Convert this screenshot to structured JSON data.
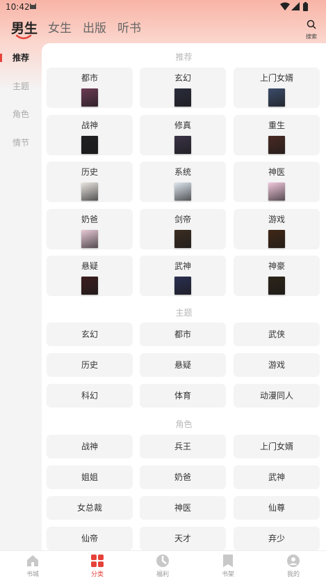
{
  "status": {
    "time": "10:42"
  },
  "top_tabs": [
    "男生",
    "女生",
    "出版",
    "听书"
  ],
  "search": {
    "label": "搜索"
  },
  "sidebar": {
    "items": [
      "推荐",
      "主题",
      "角色",
      "情节"
    ],
    "active_index": 0
  },
  "sections": {
    "recommend": {
      "title": "推荐",
      "items": [
        {
          "name": "都市",
          "cover_color": "#6b3b54"
        },
        {
          "name": "玄幻",
          "cover_color": "#2a2c3c"
        },
        {
          "name": "上门女婿",
          "cover_color": "#3c4c6a"
        },
        {
          "name": "战神",
          "cover_color": "#1f1f22"
        },
        {
          "name": "修真",
          "cover_color": "#3a3346"
        },
        {
          "name": "重生",
          "cover_color": "#4a2a24"
        },
        {
          "name": "历史",
          "cover_color": "#e8e4e0"
        },
        {
          "name": "系统",
          "cover_color": "#dde6ee"
        },
        {
          "name": "神医",
          "cover_color": "#f0c7dc"
        },
        {
          "name": "奶爸",
          "cover_color": "#e7c9d6"
        },
        {
          "name": "剑帝",
          "cover_color": "#3b2d22"
        },
        {
          "name": "游戏",
          "cover_color": "#402716"
        },
        {
          "name": "悬疑",
          "cover_color": "#3b1d1d"
        },
        {
          "name": "武神",
          "cover_color": "#2b2f52"
        },
        {
          "name": "神豪",
          "cover_color": "#2c2418"
        }
      ]
    },
    "theme": {
      "title": "主题",
      "items": [
        "玄幻",
        "都市",
        "武侠",
        "历史",
        "悬疑",
        "游戏",
        "科幻",
        "体育",
        "动漫同人"
      ]
    },
    "role": {
      "title": "角色",
      "items": [
        "战神",
        "兵王",
        "上门女婿",
        "姐姐",
        "奶爸",
        "武神",
        "女总裁",
        "神医",
        "仙尊",
        "仙帝",
        "天才",
        "弃少"
      ]
    }
  },
  "bottom_nav": {
    "items": [
      "书城",
      "分类",
      "福利",
      "书架",
      "我的"
    ],
    "active_index": 1
  },
  "colors": {
    "accent": "#e5423a",
    "panel_bg": "#ffffff",
    "card_bg": "#f4f4f4"
  }
}
